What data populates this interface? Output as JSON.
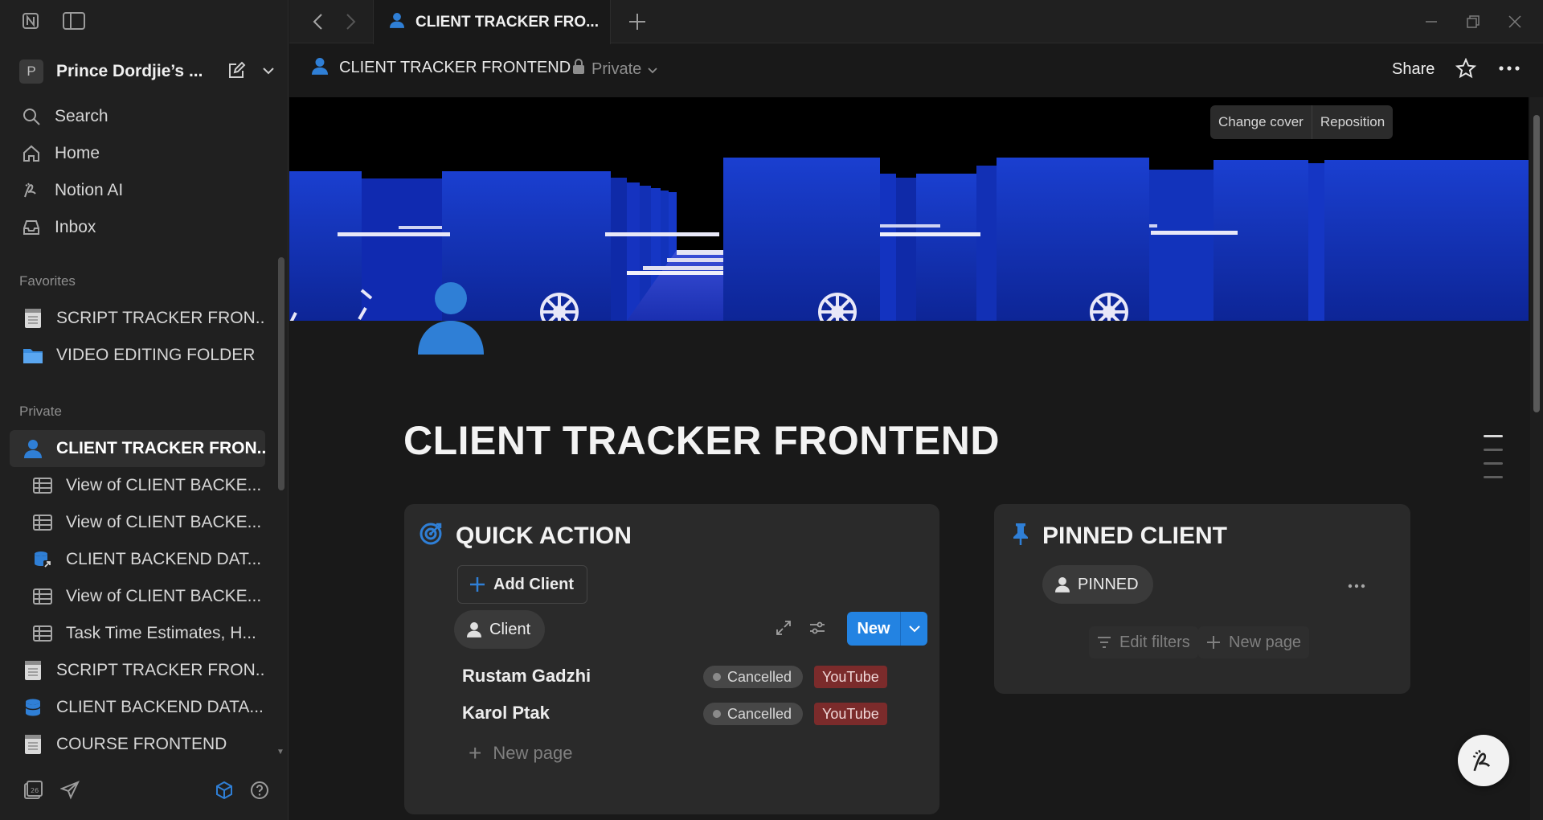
{
  "sidebar": {
    "workspace": {
      "initial": "P",
      "name": "Prince Dordjie’s ..."
    },
    "nav": [
      {
        "label": "Search",
        "icon": "search-icon"
      },
      {
        "label": "Home",
        "icon": "home-icon"
      },
      {
        "label": "Notion AI",
        "icon": "notion-ai-icon"
      },
      {
        "label": "Inbox",
        "icon": "inbox-icon"
      }
    ],
    "favorites_label": "Favorites",
    "favorites": [
      {
        "label": "SCRIPT TRACKER FRON...",
        "icon": "notepad-icon"
      },
      {
        "label": "VIDEO EDITING FOLDER",
        "icon": "folder-icon"
      }
    ],
    "private_label": "Private",
    "private": [
      {
        "label": "CLIENT TRACKER FRON...",
        "icon": "person-icon",
        "level": 0,
        "active": true
      },
      {
        "label": "View of CLIENT BACKE...",
        "icon": "table-icon",
        "level": 1
      },
      {
        "label": "View of CLIENT BACKE...",
        "icon": "table-icon",
        "level": 1
      },
      {
        "label": "CLIENT BACKEND DAT...",
        "icon": "database-link-icon",
        "level": 1
      },
      {
        "label": "View of CLIENT BACKE...",
        "icon": "table-icon",
        "level": 1
      },
      {
        "label": "Task Time Estimates, H...",
        "icon": "table-icon",
        "level": 1
      },
      {
        "label": "SCRIPT TRACKER FRON...",
        "icon": "notepad-icon",
        "level": 0
      },
      {
        "label": "CLIENT BACKEND DATA...",
        "icon": "database-icon",
        "level": 0
      },
      {
        "label": "COURSE FRONTEND",
        "icon": "notepad-icon",
        "level": 0
      }
    ]
  },
  "topbar": {
    "tab_title": "CLIENT TRACKER FRO..."
  },
  "page": {
    "breadcrumb_title": "CLIENT TRACKER FRONTEND",
    "privacy": "Private",
    "share_label": "Share",
    "cover_buttons": {
      "change": "Change cover",
      "reposition": "Reposition"
    },
    "title": "CLIENT TRACKER FRONTEND"
  },
  "quick_action": {
    "title": "QUICK ACTION",
    "add_client": "Add Client",
    "view_label": "Client",
    "new_label": "New",
    "rows": [
      {
        "name": "Rustam Gadzhi",
        "status": "Cancelled",
        "platform": "YouTube"
      },
      {
        "name": "Karol Ptak",
        "status": "Cancelled",
        "platform": "YouTube"
      }
    ],
    "new_page": "New page"
  },
  "pinned": {
    "title": "PINNED CLIENT",
    "view_label": "PINNED",
    "edit_filters": "Edit filters",
    "new_page": "New page"
  },
  "colors": {
    "accent": "#2383e2",
    "sidebar_bg": "#202020",
    "page_bg": "#191919",
    "card_bg": "#2a2a2a",
    "youtube_tag": "#7b2b2b",
    "cover_blue": "#1535b8"
  }
}
